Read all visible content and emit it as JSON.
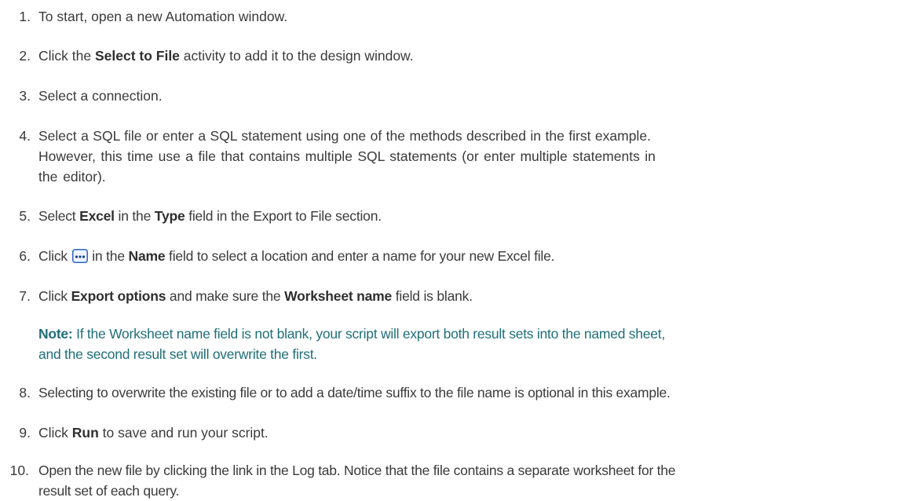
{
  "steps": [
    {
      "num": "1.",
      "segments": [
        {
          "t": "To start, open a new Automation window.",
          "b": false
        }
      ]
    },
    {
      "num": "2.",
      "segments": [
        {
          "t": "Click the ",
          "b": false
        },
        {
          "t": "Select to File",
          "b": true
        },
        {
          "t": " activity to add it to the design window.",
          "b": false
        }
      ]
    },
    {
      "num": "3.",
      "segments": [
        {
          "t": "Select a connection.",
          "b": false
        }
      ]
    },
    {
      "num": "4.",
      "lines": [
        "Select a SQL file or enter a SQL statement using one of the methods described in the first example.",
        "However, this time use a file that contains multiple SQL statements (or enter multiple statements in",
        "the editor)."
      ]
    },
    {
      "num": "5.",
      "segments": [
        {
          "t": "Select ",
          "b": false
        },
        {
          "t": "Excel",
          "b": true
        },
        {
          "t": " in the ",
          "b": false
        },
        {
          "t": "Type",
          "b": true
        },
        {
          "t": " field in the Export to File section.",
          "b": false
        }
      ]
    },
    {
      "num": "6.",
      "before": "Click ",
      "icon": "ellipsis-button-icon",
      "after_segments": [
        {
          "t": " in the ",
          "b": false
        },
        {
          "t": "Name",
          "b": true
        },
        {
          "t": " field to select a location and enter a name for your new Excel file.",
          "b": false
        }
      ]
    },
    {
      "num": "7.",
      "segments": [
        {
          "t": "Click ",
          "b": false
        },
        {
          "t": "Export options",
          "b": true
        },
        {
          "t": " and make sure the ",
          "b": false
        },
        {
          "t": "Worksheet name",
          "b": true
        },
        {
          "t": " field is blank.",
          "b": false
        }
      ]
    },
    {
      "num": "8.",
      "segments": [
        {
          "t": "Selecting to overwrite the existing file or to add a date/time suffix to the file name is optional in this example.",
          "b": false
        }
      ]
    },
    {
      "num": "9.",
      "segments": [
        {
          "t": "Click ",
          "b": false
        },
        {
          "t": "Run",
          "b": true
        },
        {
          "t": " to save and run your script.",
          "b": false
        }
      ]
    },
    {
      "num": "10.",
      "lines": [
        "Open the new file by clicking the link in the Log tab. Notice that the file contains a separate worksheet for the",
        "result set of each query."
      ]
    }
  ],
  "note": {
    "label": "Note:",
    "line1": " If the Worksheet name field is not blank, your script will export both result sets into the named sheet,",
    "line2": "and the second result set will overwrite the first."
  },
  "colors": {
    "text": "#3a3a3a",
    "note": "#1f6e78",
    "icon_border": "#2a64c8"
  }
}
